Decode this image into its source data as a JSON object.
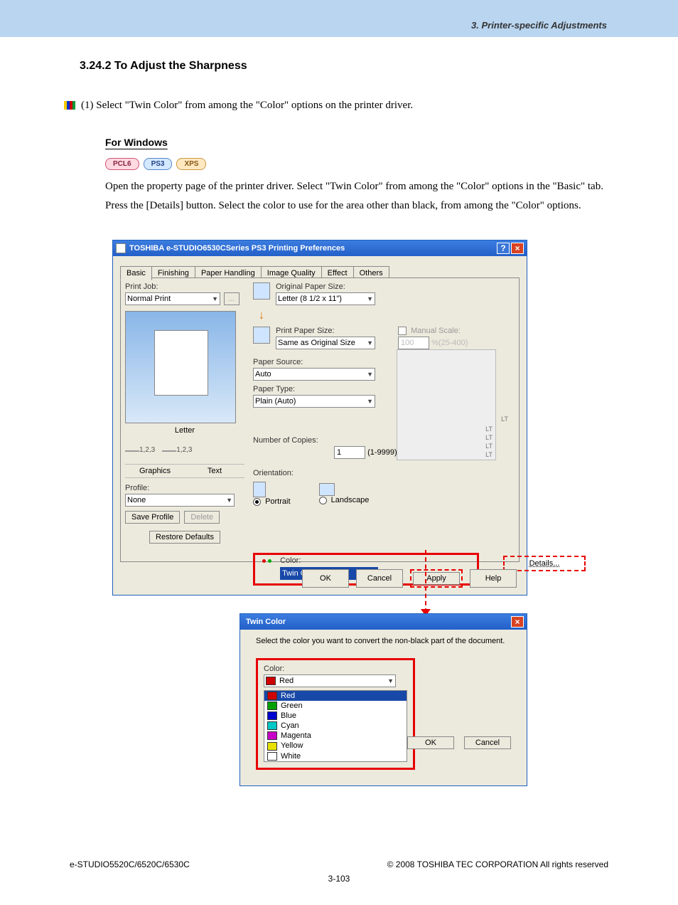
{
  "page": {
    "header": "3. Printer-specific Adjustments",
    "section_title": "3.24.2  To Adjust the Sharpness",
    "step1": "(1)   Select \"Twin Color\" from among the \"Color\" options on the printer driver.",
    "for_windows": "For Windows",
    "pills": {
      "pcl6": "PCL6",
      "ps3": "PS3",
      "xps": "XPS"
    },
    "win_body": "Open the property page of the printer driver. Select \"Twin Color\" from among the \"Color\" options in the \"Basic\" tab. Press the [Details] button. Select the color to use for the area other than black, from among the \"Color\" options.",
    "footer_left": "e-STUDIO5520C/6520C/6530C",
    "footer_right": "© 2008 TOSHIBA TEC CORPORATION All rights reserved",
    "page_num": "3-103"
  },
  "dlg_main": {
    "title": "TOSHIBA e-STUDIO6530CSeries PS3 Printing Preferences",
    "tabs": [
      "Basic",
      "Finishing",
      "Paper Handling",
      "Image Quality",
      "Effect",
      "Others"
    ],
    "print_job_label": "Print Job:",
    "print_job_value": "Normal Print",
    "paper_label": "Letter",
    "graph_text": [
      "Graphics",
      "Text"
    ],
    "icon_nums": [
      "1,2,3",
      "1,2,3"
    ],
    "profile_label": "Profile:",
    "profile_value": "None",
    "save_profile": "Save Profile",
    "delete": "Delete",
    "restore": "Restore Defaults",
    "orig_size_label": "Original Paper Size:",
    "orig_size_value": "Letter (8 1/2 x 11\")",
    "print_size_label": "Print Paper Size:",
    "print_size_value": "Same as Original Size",
    "manual_scale_label": "Manual Scale:",
    "scale_value": "100",
    "scale_range": "%(25-400)",
    "paper_source_label": "Paper Source:",
    "paper_source_value": "Auto",
    "paper_type_label": "Paper Type:",
    "paper_type_value": "Plain (Auto)",
    "copies_label": "Number of Copies:",
    "copies_value": "1",
    "copies_range": "(1-9999)",
    "orientation_label": "Orientation:",
    "portrait": "Portrait",
    "landscape": "Landscape",
    "color_label": "Color:",
    "color_value": "Twin Color",
    "details": "Details...",
    "trays": [
      "LT",
      "LT",
      "LT",
      "LT",
      "LT"
    ],
    "buttons": {
      "ok": "OK",
      "cancel": "Cancel",
      "apply": "Apply",
      "help": "Help"
    }
  },
  "dlg_twin": {
    "title": "Twin Color",
    "msg": "Select the color you want to convert the non-black part of the document.",
    "color_label": "Color:",
    "selected": "Red",
    "options": [
      {
        "name": "Red",
        "hex": "#d00000"
      },
      {
        "name": "Green",
        "hex": "#00a000"
      },
      {
        "name": "Blue",
        "hex": "#0000d0"
      },
      {
        "name": "Cyan",
        "hex": "#00c8c8"
      },
      {
        "name": "Magenta",
        "hex": "#c800c8"
      },
      {
        "name": "Yellow",
        "hex": "#e8e000"
      },
      {
        "name": "White",
        "hex": "#ffffff"
      }
    ],
    "buttons": {
      "ok": "OK",
      "cancel": "Cancel"
    }
  }
}
